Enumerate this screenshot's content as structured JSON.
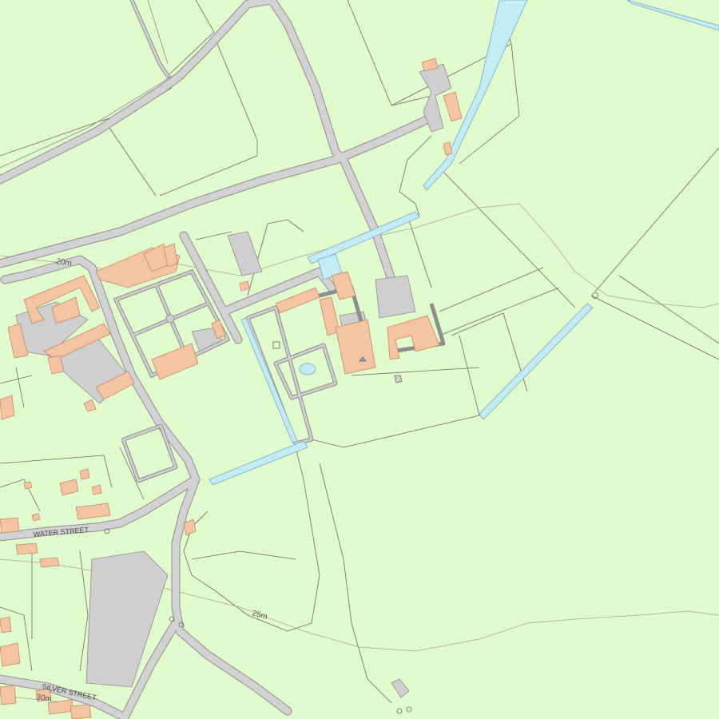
{
  "map": {
    "colors": {
      "land": "#e0fccc",
      "road_fill": "#d2d2d2",
      "road_edge": "#8e8e8e",
      "building": "#f5c4a0",
      "building_edge": "#c08a6a",
      "structure": "#cfcfcf",
      "water": "#c4ecf4",
      "water_edge": "#7aa8c8",
      "field_line": "#6a6a6a",
      "contour": "#b4a088"
    },
    "labels": {
      "water_street": "WATER STREET",
      "silver_street": "SILVER STREET",
      "contour_20": "20m",
      "contour_25": "25m",
      "contour_30": "30m"
    }
  }
}
